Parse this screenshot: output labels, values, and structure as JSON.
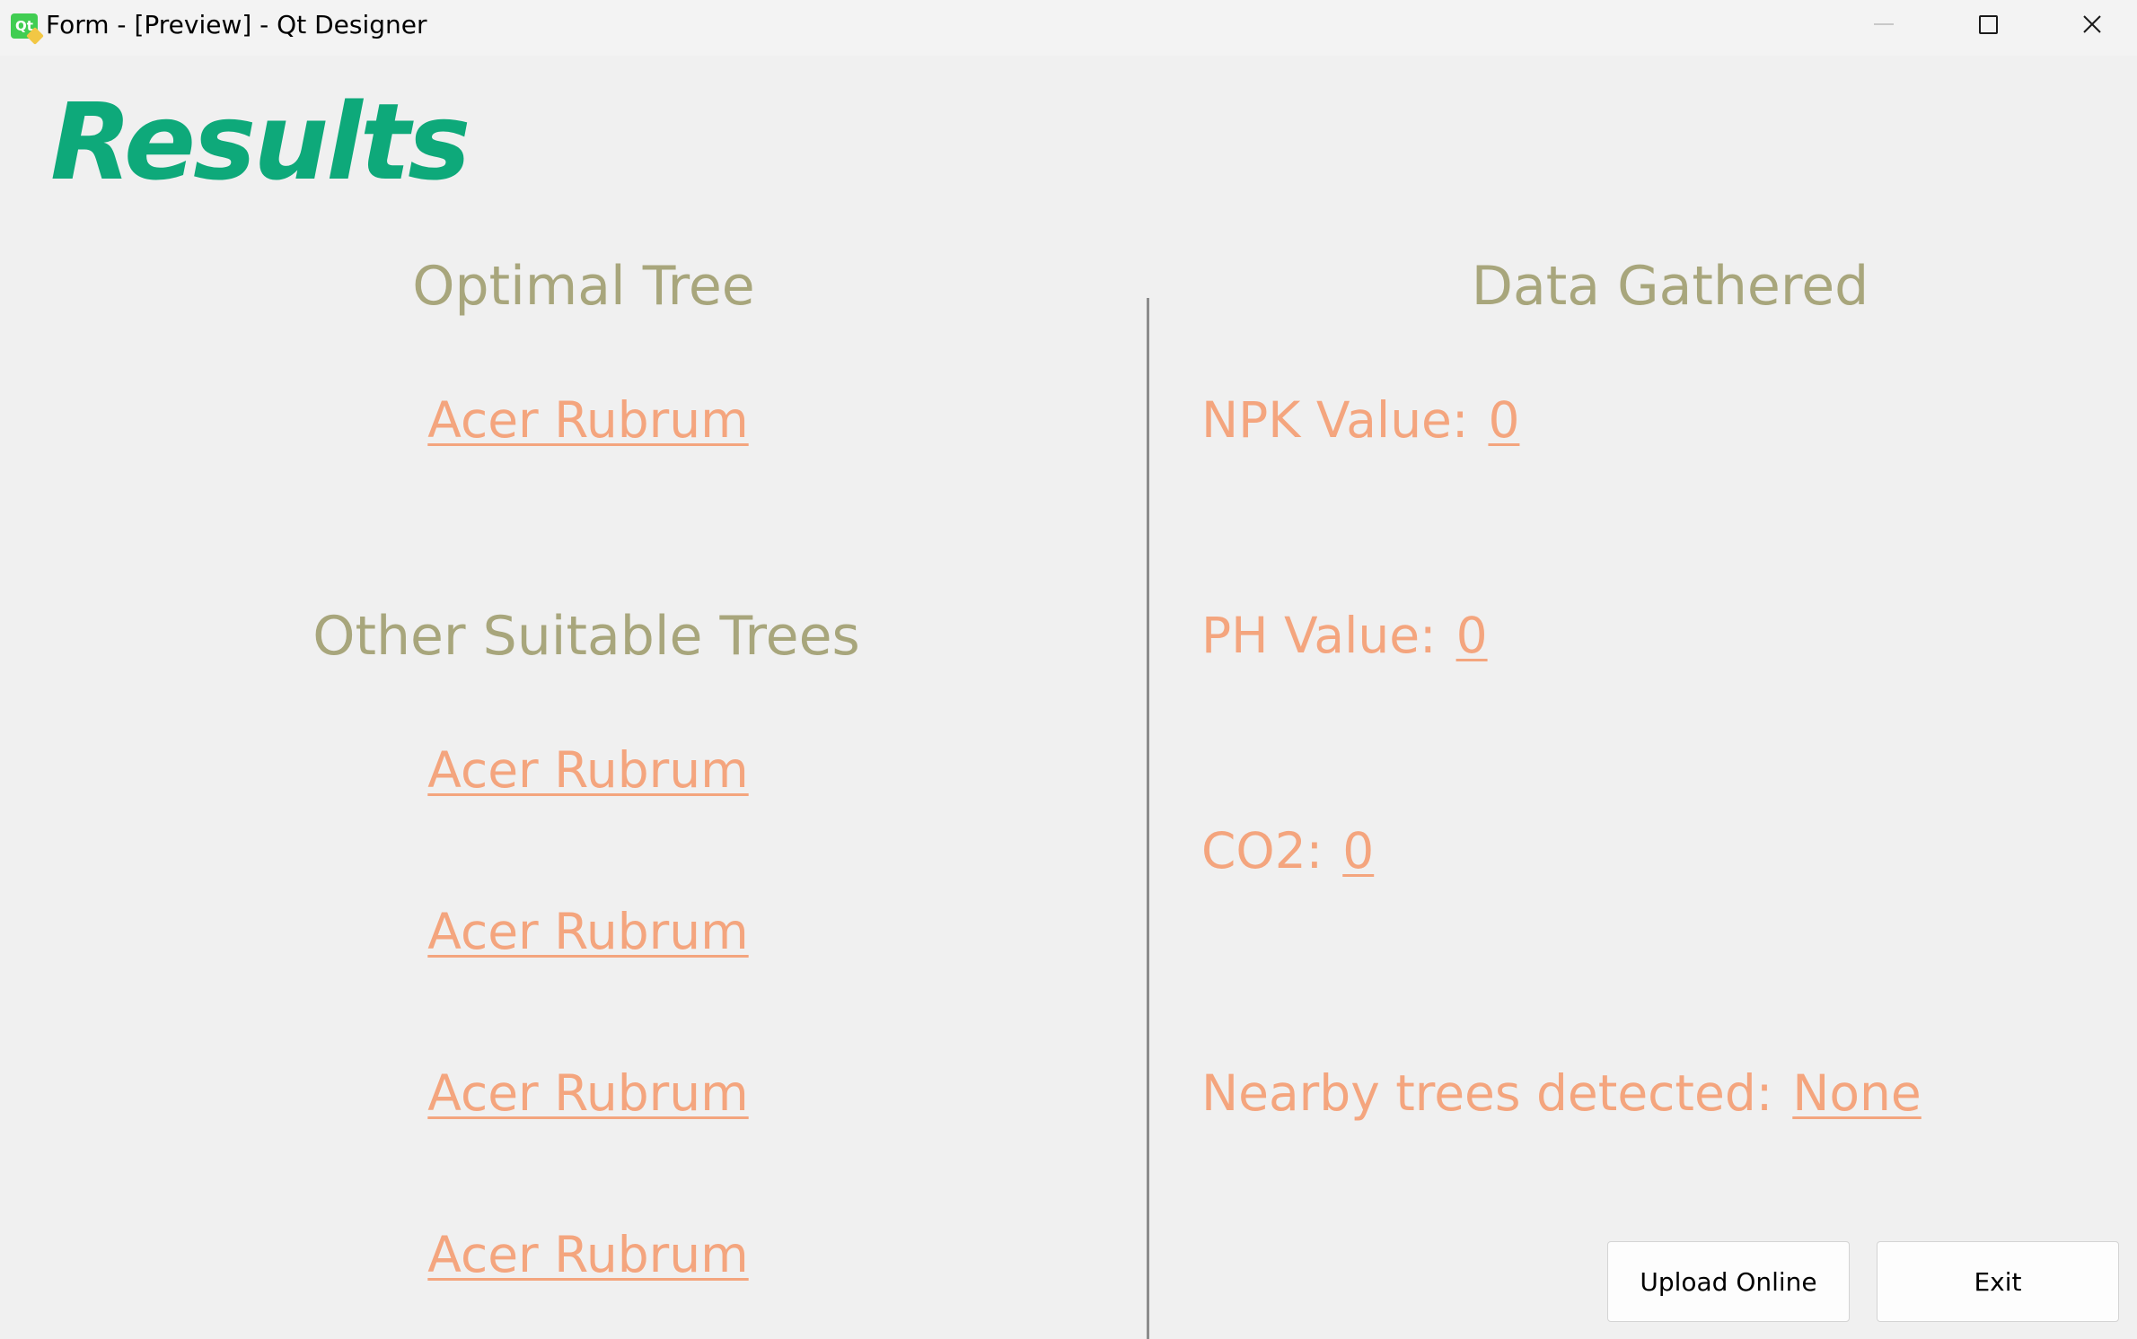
{
  "window": {
    "title": "Form - [Preview] - Qt Designer",
    "app_icon_text": "Qt",
    "icons": [
      "qt-designer-icon",
      "minimize-icon",
      "maximize-icon",
      "close-icon"
    ]
  },
  "page": {
    "title": "Results"
  },
  "optimal": {
    "header": "Optimal Tree",
    "tree": "Acer Rubrum"
  },
  "other": {
    "header": "Other Suitable Trees",
    "trees": [
      "Acer Rubrum",
      "Acer Rubrum",
      "Acer Rubrum",
      "Acer Rubrum"
    ]
  },
  "data": {
    "header": "Data Gathered",
    "npk": {
      "label": "NPK Value:",
      "value": "0"
    },
    "ph": {
      "label": "PH Value:",
      "value": "0"
    },
    "co2": {
      "label": "CO2:",
      "value": "0"
    },
    "nearby": {
      "label": "Nearby trees detected:",
      "value": "None"
    }
  },
  "buttons": {
    "upload": "Upload Online",
    "exit": "Exit"
  },
  "colors": {
    "title": "#0ea97a",
    "header": "#a8a67c",
    "link": "#f4a57e",
    "background": "#f0f0f0"
  }
}
